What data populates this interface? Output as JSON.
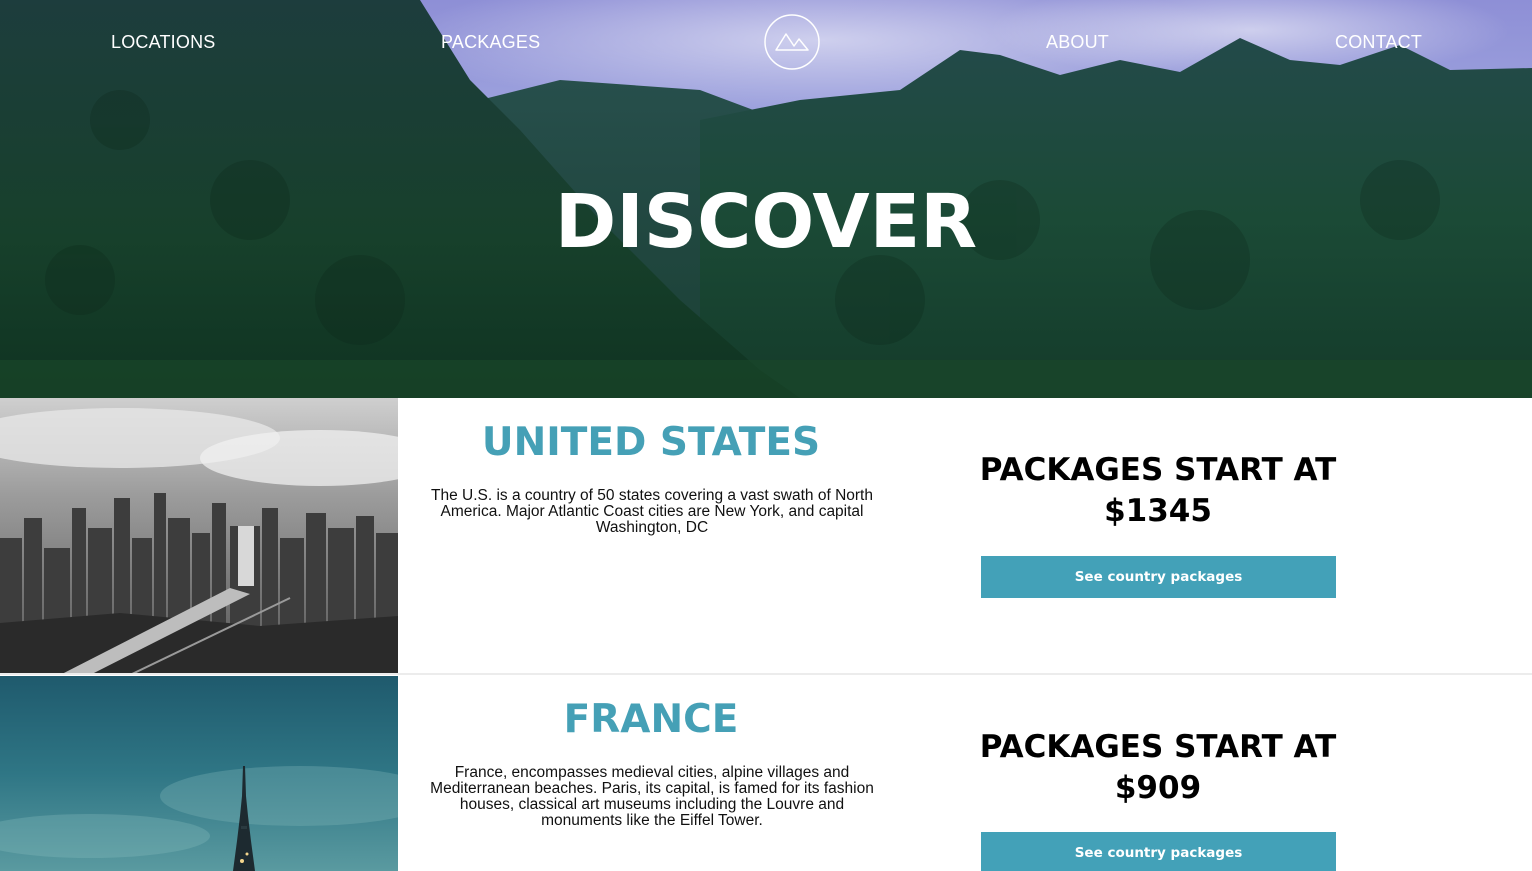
{
  "nav": {
    "items": [
      {
        "label": "LOCATIONS"
      },
      {
        "label": "PACKAGES"
      },
      {
        "label": "ABOUT"
      },
      {
        "label": "CONTACT"
      }
    ],
    "logo_icon": "mountain-logo-icon"
  },
  "hero": {
    "title": "DISCOVER",
    "background": "green-mountains-photo"
  },
  "countries": [
    {
      "name": "UNITED STATES",
      "description": "The U.S. is a country of 50 states covering a vast swath of North America. Major Atlantic Coast cities are New York, and capital Washington, DC",
      "price_prefix": "PACKAGES START AT",
      "price": "$1345",
      "button_label": "See country packages",
      "photo": "city-skyline-photo"
    },
    {
      "name": "FRANCE",
      "description": "France, encompasses medieval cities, alpine villages and Mediterranean beaches. Paris, its capital, is famed for its fashion houses, classical art museums including the Louvre and monuments like the Eiffel Tower.",
      "price_prefix": "PACKAGES START AT",
      "price": "$909",
      "button_label": "See country packages",
      "photo": "eiffel-tower-photo"
    }
  ],
  "colors": {
    "accent": "#43a1b8",
    "heading_accent": "#45a0b6",
    "text": "#111111"
  }
}
